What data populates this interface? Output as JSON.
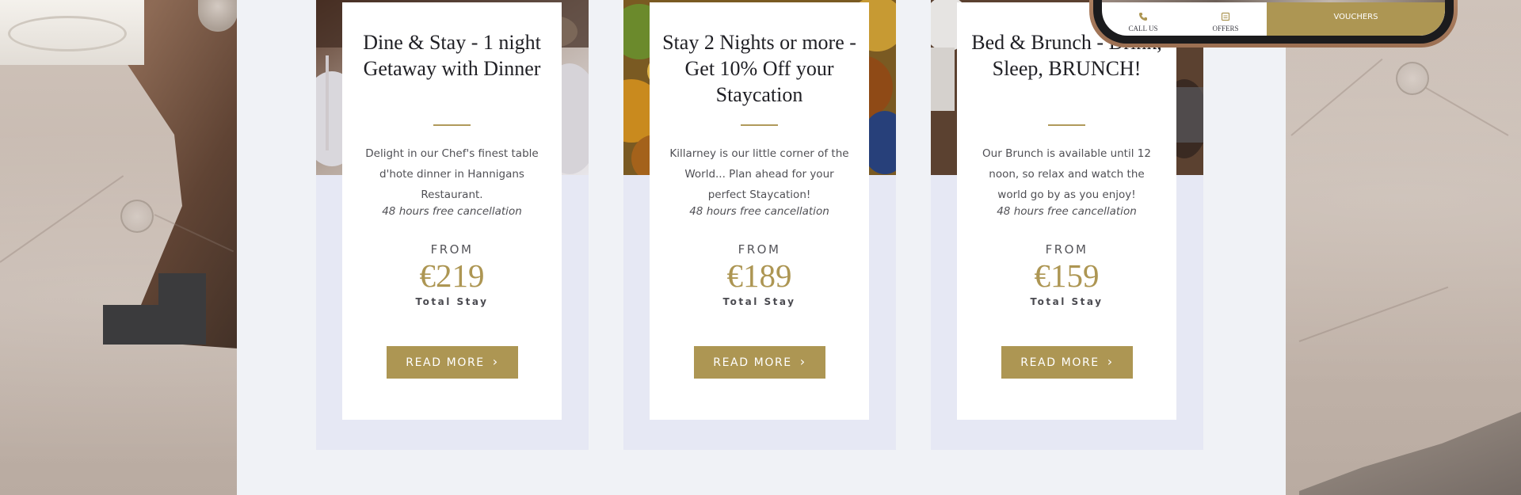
{
  "offers": [
    {
      "title": "Dine & Stay - 1 night Getaway with Dinner",
      "description": "Delight in our Chef's finest table d'hote dinner in Hannigans Restaurant.",
      "cancellation": "48 hours free cancellation",
      "from_label": "FROM",
      "price": "€219",
      "price_note": "Total Stay",
      "button_label": "READ MORE"
    },
    {
      "title": "Stay 2 Nights or more - Get 10% Off your Staycation",
      "description": "Killarney is our little corner of the World... Plan ahead for your perfect Staycation!",
      "cancellation": "48 hours free cancellation",
      "from_label": "FROM",
      "price": "€189",
      "price_note": "Total Stay",
      "button_label": "READ MORE"
    },
    {
      "title": "Bed & Brunch - Drink, Sleep, BRUNCH!",
      "description": "Our Brunch is available until 12 noon, so relax and watch the world go by as you enjoy!",
      "cancellation": "48 hours free cancellation",
      "from_label": "FROM",
      "price": "€159",
      "price_note": "Total Stay",
      "button_label": "READ MORE"
    }
  ],
  "phone_nav": {
    "call_us": "CALL US",
    "offers": "OFFERS",
    "vouchers": "VOUCHERS"
  },
  "colors": {
    "accent_gold": "#ad9653",
    "panel_bg": "#f0f2f6",
    "offer_frame": "#e6e8f4"
  }
}
